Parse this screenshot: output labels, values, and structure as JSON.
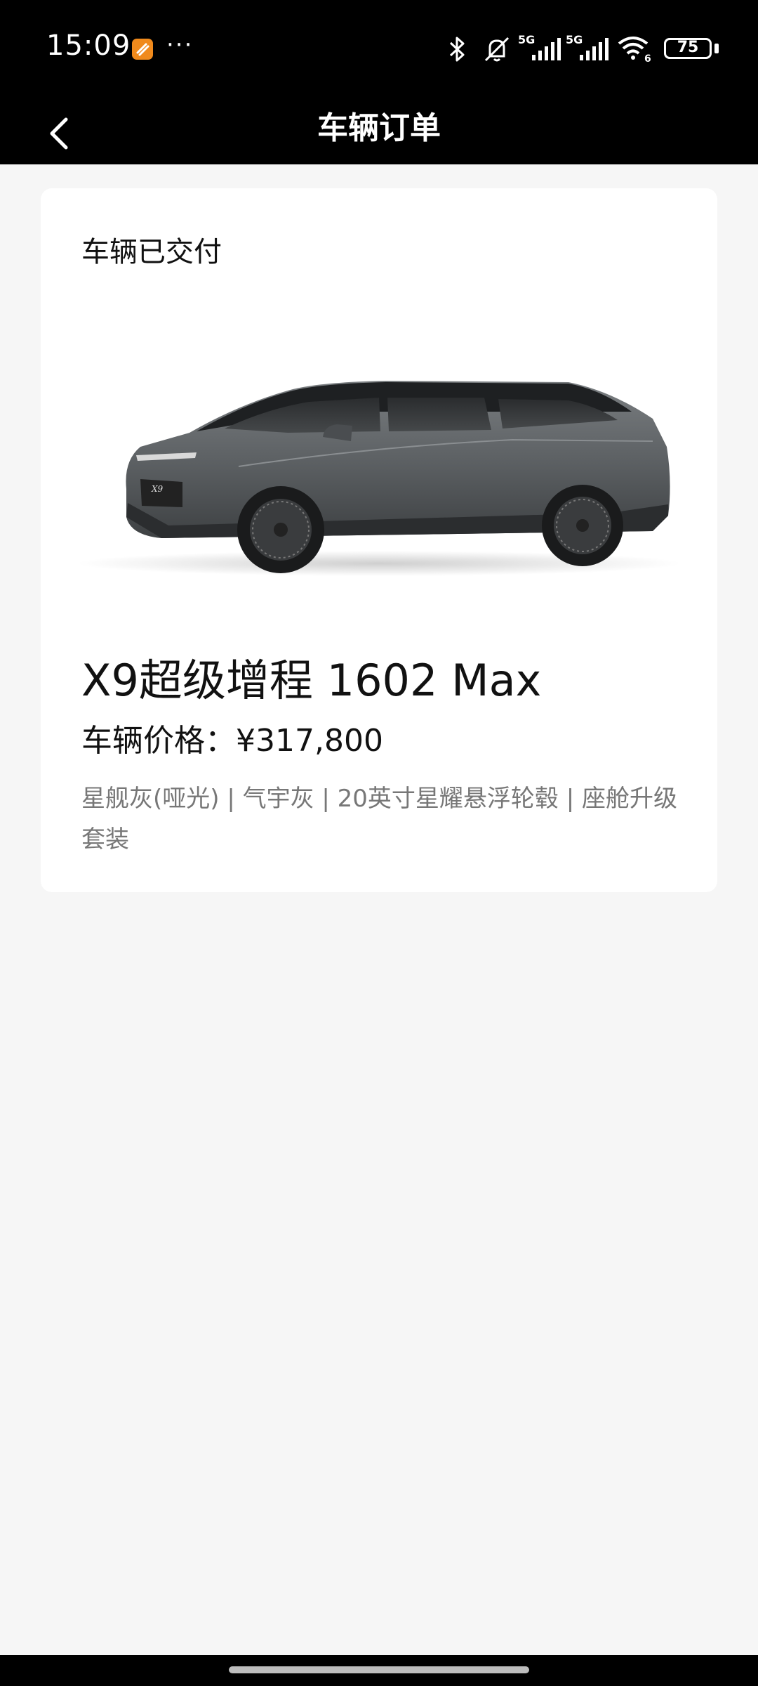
{
  "status_bar": {
    "time": "15:09",
    "more": "···",
    "battery": "75",
    "network_labels": [
      "5G",
      "5G"
    ],
    "wifi_badge": "6"
  },
  "header": {
    "title": "车辆订单"
  },
  "order": {
    "status": "车辆已交付",
    "car_name": "X9超级增程 1602 Max",
    "price_label": "车辆价格：",
    "price_value": "¥317,800",
    "options": "星舰灰(哑光) | 气宇灰 | 20英寸星耀悬浮轮毂 | 座舱升级套装"
  },
  "icons": {
    "back": "chevron-left-icon",
    "bluetooth": "bluetooth-icon",
    "mute": "bell-muted-icon",
    "signal": "signal-icon",
    "wifi": "wifi-icon",
    "battery": "battery-icon"
  },
  "colors": {
    "header_bg": "#000000",
    "page_bg": "#f6f6f6",
    "card_bg": "#ffffff",
    "car_body": "#5f6366"
  }
}
